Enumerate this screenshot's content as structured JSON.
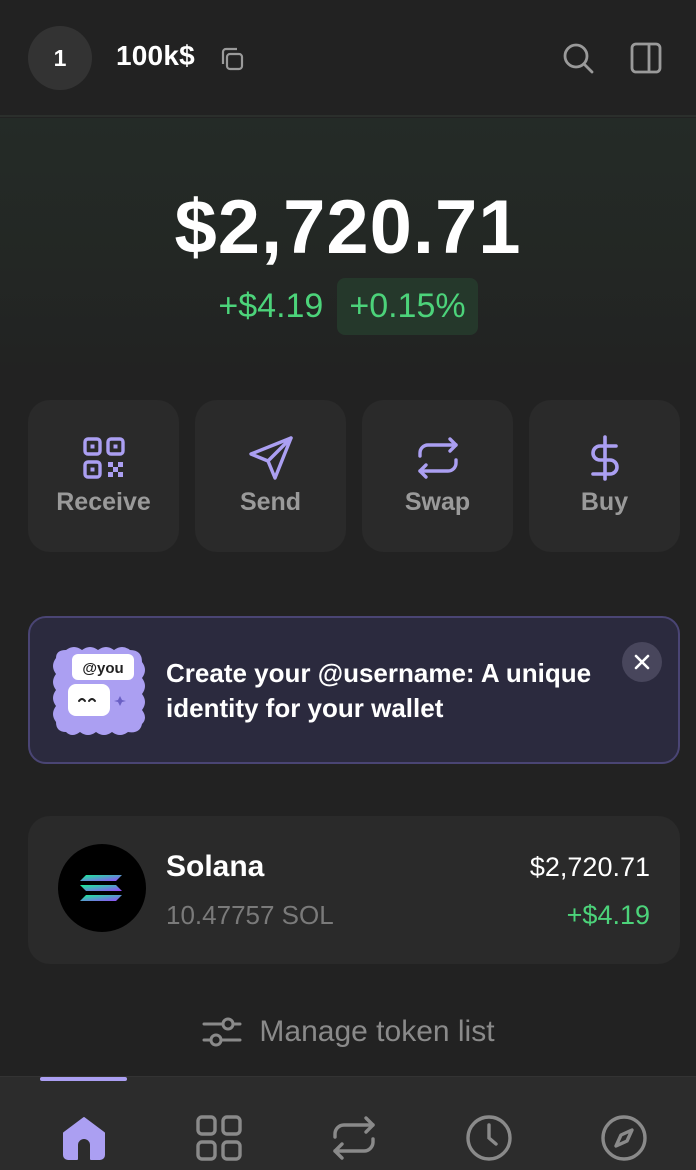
{
  "header": {
    "avatar_label": "1",
    "account_name": "100k$",
    "icons": [
      "copy-icon",
      "search-icon",
      "sidebar-icon"
    ]
  },
  "balance": {
    "total": "$2,720.71",
    "change_abs": "+$4.19",
    "change_pct": "+0.15%"
  },
  "actions": [
    {
      "label": "Receive",
      "icon": "qr-code-icon"
    },
    {
      "label": "Send",
      "icon": "send-icon"
    },
    {
      "label": "Swap",
      "icon": "swap-icon"
    },
    {
      "label": "Buy",
      "icon": "dollar-icon"
    }
  ],
  "banner": {
    "badge": "@you",
    "text": "Create your @username: A unique identity for your wallet"
  },
  "tokens": [
    {
      "name": "Solana",
      "amount": "10.47757 SOL",
      "value": "$2,720.71",
      "change": "+$4.19"
    }
  ],
  "manage_label": "Manage token list",
  "nav": {
    "items": [
      "home-icon",
      "collectibles-grid-icon",
      "swap-icon",
      "history-clock-icon",
      "explore-compass-icon"
    ],
    "active_index": 0
  },
  "colors": {
    "accent": "#ab9ff2",
    "positive": "#4cd37a",
    "background": "#222222",
    "card": "#2a2a2a"
  }
}
